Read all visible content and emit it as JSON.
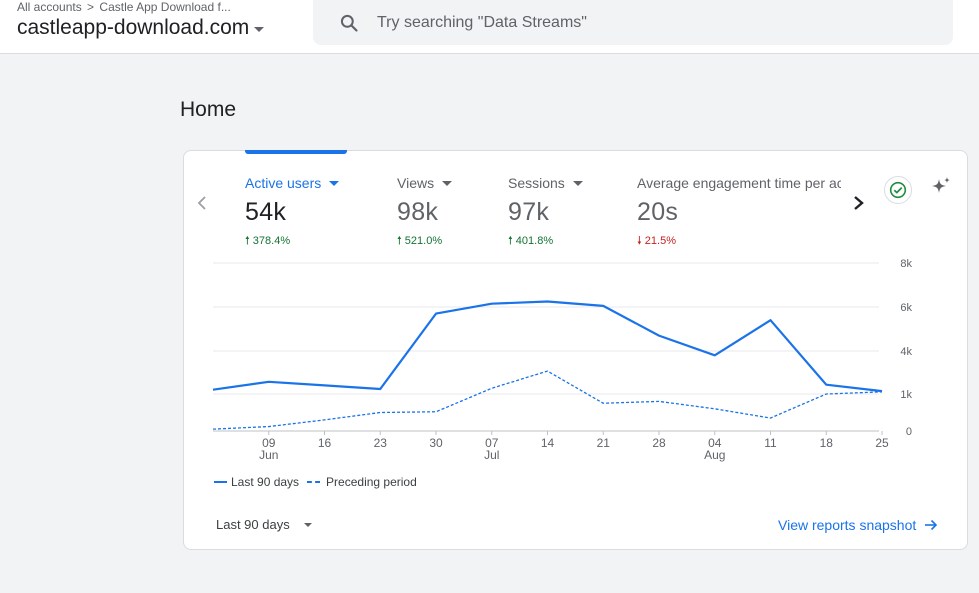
{
  "header": {
    "breadcrumb_root": "All accounts",
    "breadcrumb_separator": ">",
    "breadcrumb_account": "Castle App Download f...",
    "property_name": "castleapp-download.com",
    "search_placeholder": "Try searching \"Data Streams\""
  },
  "page": {
    "title": "Home"
  },
  "metrics": [
    {
      "label": "Active users",
      "value": "54k",
      "change": "378.4%",
      "direction": "up",
      "active": true
    },
    {
      "label": "Views",
      "value": "98k",
      "change": "521.0%",
      "direction": "up"
    },
    {
      "label": "Sessions",
      "value": "97k",
      "change": "401.8%",
      "direction": "up"
    },
    {
      "label": "Average engagement time per active user",
      "value": "20s",
      "change": "21.5%",
      "direction": "down"
    }
  ],
  "icons": {
    "nav_left": "chevron-left-icon",
    "nav_right": "chevron-right-icon",
    "check": "check-circle-icon",
    "insights": "sparkle-icon",
    "up": "arrow-up-icon",
    "down": "arrow-down-icon",
    "link_arrow": "arrow-right-icon"
  },
  "colors": {
    "accent": "#1a73e8",
    "positive": "#137333",
    "negative": "#c5221f",
    "check": "#1e8e3e"
  },
  "chart_data": {
    "type": "line",
    "x_ticks": [
      {
        "label": "09",
        "sublabel": "Jun"
      },
      {
        "label": "16",
        "sublabel": ""
      },
      {
        "label": "23",
        "sublabel": ""
      },
      {
        "label": "30",
        "sublabel": ""
      },
      {
        "label": "07",
        "sublabel": "Jul"
      },
      {
        "label": "14",
        "sublabel": ""
      },
      {
        "label": "21",
        "sublabel": ""
      },
      {
        "label": "28",
        "sublabel": ""
      },
      {
        "label": "04",
        "sublabel": "Aug"
      },
      {
        "label": "11",
        "sublabel": ""
      },
      {
        "label": "18",
        "sublabel": ""
      },
      {
        "label": "25",
        "sublabel": ""
      }
    ],
    "y_ticks": [
      "8k",
      "6k",
      "4k",
      "1k",
      "0"
    ],
    "grid": true,
    "legend_position": "bottom-left",
    "series": [
      {
        "name": "Last 90 days",
        "style": "solid",
        "x": [
          "06-02",
          "06-09",
          "06-16",
          "06-23",
          "06-30",
          "07-07",
          "07-14",
          "07-21",
          "07-28",
          "08-04",
          "08-11",
          "08-18",
          "08-25"
        ],
        "values": [
          1300,
          1850,
          1600,
          1350,
          5700,
          6150,
          6250,
          6050,
          4700,
          3700,
          5400,
          1650,
          1200
        ]
      },
      {
        "name": "Preceding period",
        "style": "dashed",
        "x": [
          "06-02",
          "06-09",
          "06-16",
          "06-23",
          "06-30",
          "07-07",
          "07-14",
          "07-21",
          "07-28",
          "08-04",
          "08-11",
          "08-18",
          "08-25"
        ],
        "values": [
          50,
          120,
          300,
          500,
          520,
          1400,
          2600,
          750,
          800,
          600,
          350,
          1000,
          1150
        ]
      }
    ]
  },
  "footer": {
    "range_label": "Last 90 days",
    "view_link": "View reports snapshot"
  }
}
